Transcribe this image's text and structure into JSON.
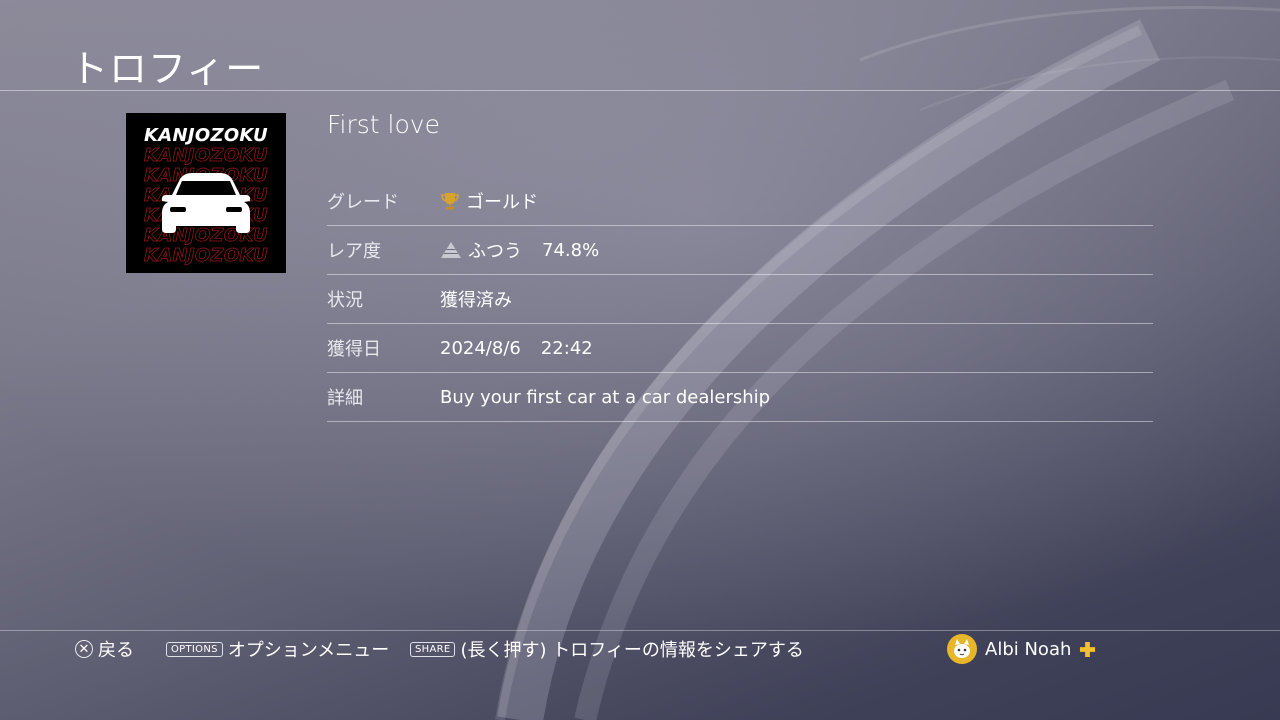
{
  "header": {
    "title": "トロフィー"
  },
  "trophy": {
    "art_text": "KANJOZOKU",
    "name": "First love",
    "rows": [
      {
        "label": "グレード",
        "icon": "gold-trophy-icon",
        "value": "ゴールド"
      },
      {
        "label": "レア度",
        "icon": "rarity-pyramid-icon",
        "value": "ふつう",
        "extra": "74.8%"
      },
      {
        "label": "状況",
        "value": "獲得済み"
      },
      {
        "label": "獲得日",
        "value": "2024/8/6",
        "extra": "22:42"
      },
      {
        "label": "詳細",
        "value": "Buy your first car at a car dealership"
      }
    ]
  },
  "footer": {
    "back_symbol": "✕",
    "back_label": "戻る",
    "options_key": "OPTIONS",
    "options_label": "オプションメニュー",
    "share_key": "SHARE",
    "share_label": "(長く押す) トロフィーの情報をシェアする",
    "user_name": "Albi Noah"
  },
  "colors": {
    "accent_gold": "#e8b62a",
    "plus_yellow": "#f2c12e",
    "art_red": "#a01818"
  }
}
